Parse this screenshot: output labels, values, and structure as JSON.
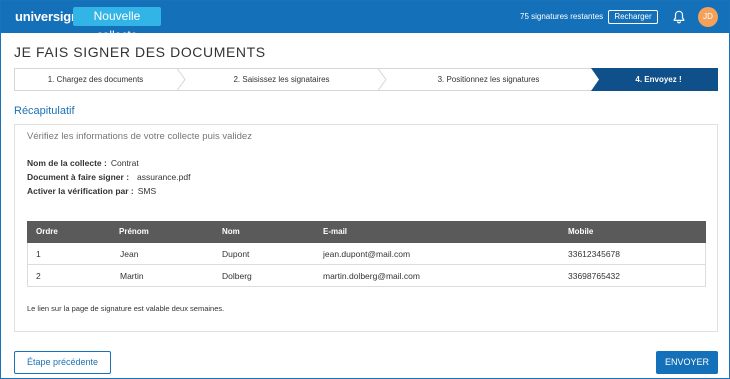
{
  "header": {
    "logo": "universign",
    "new_button": "Nouvelle collecte",
    "signatures_left": "75 signatures restantes",
    "reload_button": "Recharger",
    "bell_icon": "bell-icon",
    "avatar_initials": "JD",
    "avatar_color": "#f6a15a",
    "brand_color": "#1470b8",
    "accent_color": "#33b4e6"
  },
  "page_title": "JE FAIS SIGNER DES DOCUMENTS",
  "steps": [
    {
      "label": "1. Chargez des documents",
      "active": false
    },
    {
      "label": "2. Saisissez les signataires",
      "active": false
    },
    {
      "label": "3. Positionnez les signatures",
      "active": false
    },
    {
      "label": "4. Envoyez !",
      "active": true
    }
  ],
  "recap": {
    "title": "Récapitulatif",
    "instruction": "Vérifiez les informations de votre collecte puis validez",
    "fields": [
      {
        "label": "Nom de la collecte :",
        "value": "Contrat"
      },
      {
        "label": "Document à faire signer :",
        "value": "assurance.pdf"
      },
      {
        "label": "Activer la vérification par :",
        "value": "SMS"
      }
    ],
    "table": {
      "headers": [
        "Ordre",
        "Prénom",
        "Nom",
        "E-mail",
        "Mobile"
      ],
      "rows": [
        [
          "1",
          "Jean",
          "Dupont",
          "jean.dupont@mail.com",
          "33612345678"
        ],
        [
          "2",
          "Martin",
          "Dolberg",
          "martin.dolberg@mail.com",
          "33698765432"
        ]
      ]
    },
    "footnote": "Le lien sur la page de signature est valable deux semaines."
  },
  "actions": {
    "prev": "Étape précédente",
    "send": "ENVOYER"
  }
}
